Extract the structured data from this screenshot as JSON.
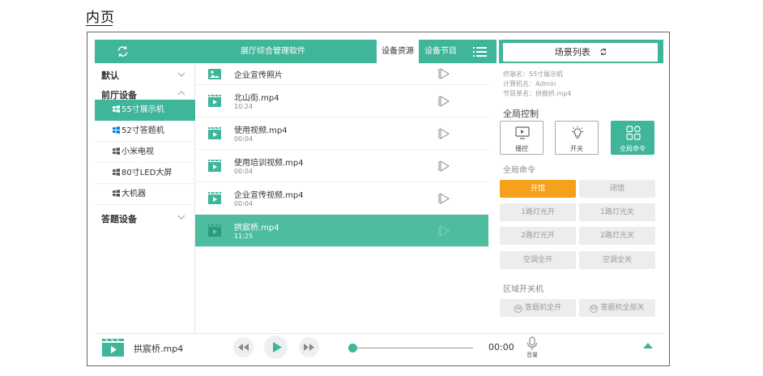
{
  "caption": "内页",
  "topbar": {
    "title": "展厅综合管理软件",
    "tabs": [
      "设备资源",
      "设备节目"
    ],
    "scene_button": "场景列表"
  },
  "sidebar": {
    "groups": [
      {
        "label": "默认",
        "expanded": false
      },
      {
        "label": "前厅设备",
        "expanded": true
      },
      {
        "label": "答题设备",
        "expanded": false
      }
    ],
    "devices": [
      "55寸展示机",
      "52寸答题机",
      "小米电视",
      "80寸LED大屏",
      "大机器"
    ],
    "active_device": "55寸展示机"
  },
  "media": {
    "items": [
      {
        "name": "企业宣传照片",
        "time": "",
        "type": "image"
      },
      {
        "name": "北山街.mp4",
        "time": "10:24",
        "type": "video"
      },
      {
        "name": "使用视频.mp4",
        "time": "00:04",
        "type": "video"
      },
      {
        "name": "使用培训视频.mp4",
        "time": "00:04",
        "type": "video"
      },
      {
        "name": "企业宣传视频.mp4",
        "time": "00:04",
        "type": "video"
      },
      {
        "name": "拱宸桥.mp4",
        "time": "11:25",
        "type": "video"
      }
    ],
    "active": "拱宸桥.mp4"
  },
  "info": {
    "terminal": "终端名：55寸展示机",
    "computer": "计算机名：Admin",
    "program": "节目单名：拱宸桥.mp4"
  },
  "global_control": {
    "heading": "全局控制",
    "buttons": [
      "播控",
      "开关",
      "全局命令"
    ],
    "active": "全局命令"
  },
  "global_commands": {
    "heading": "全局命令",
    "buttons": [
      "开馆",
      "闭馆",
      "1路灯光开",
      "1路灯光关",
      "2路灯光开",
      "2路灯光关",
      "空调全开",
      "空调全关"
    ],
    "primary": "开馆"
  },
  "zone_power": {
    "heading": "区域开关机",
    "buttons": [
      "答题机全开",
      "答题机全部关"
    ],
    "icon_labels": [
      "ON",
      "OFF"
    ]
  },
  "player": {
    "now_playing": "拱宸桥.mp4",
    "time": "00:00",
    "progress": 0,
    "volume_label": "音量"
  },
  "colors": {
    "accent": "#3fb59a",
    "primary_button": "#f5a11c"
  }
}
